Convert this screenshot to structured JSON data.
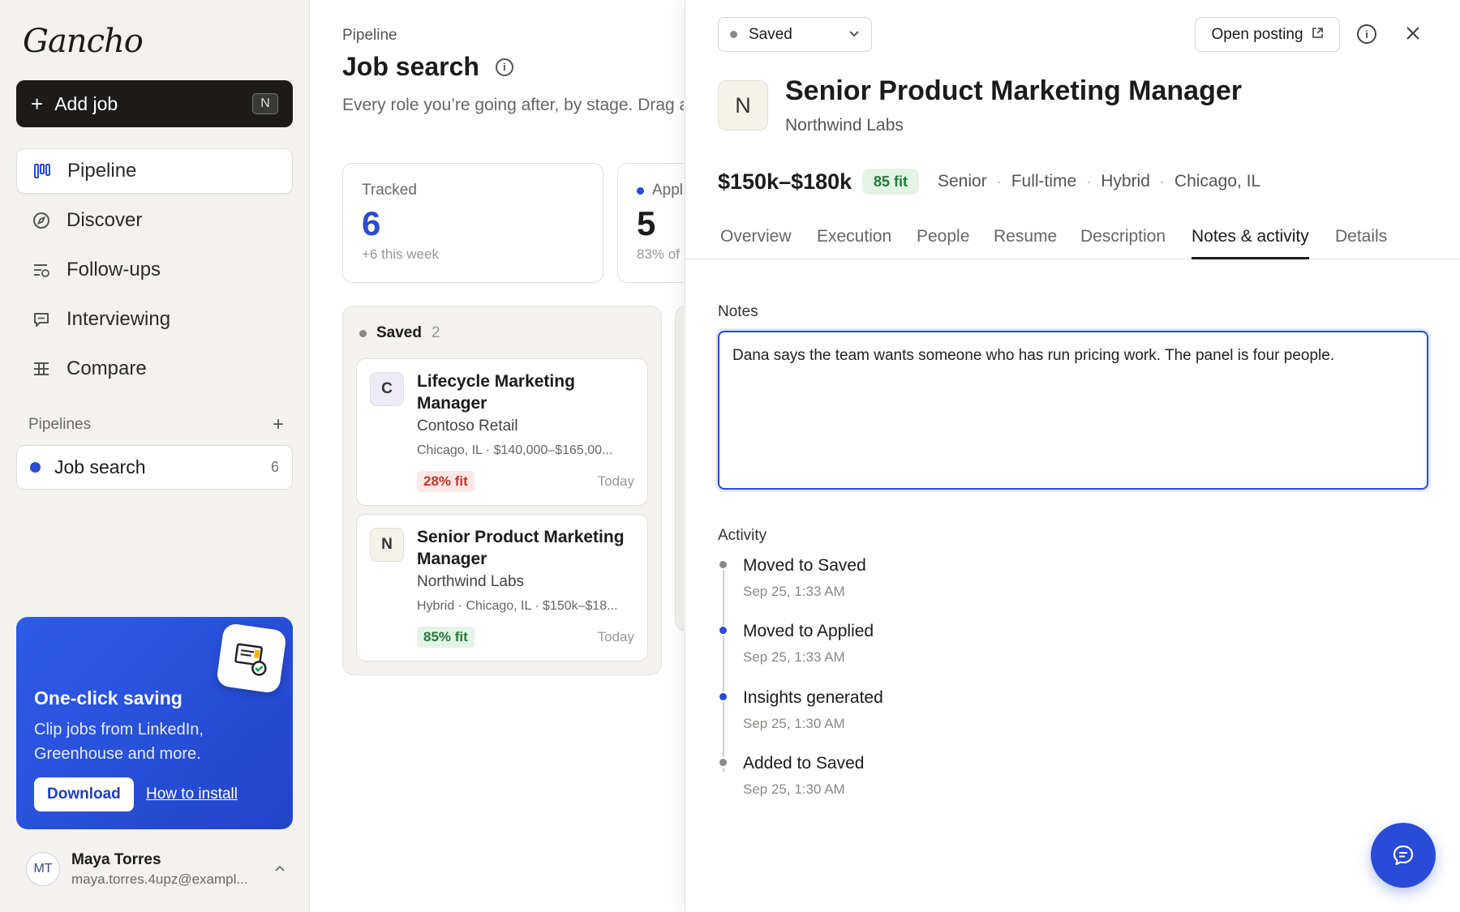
{
  "app": {
    "logo": "Gancho"
  },
  "sidebar": {
    "add_job": {
      "label": "Add job",
      "shortcut": "N"
    },
    "nav": [
      {
        "label": "Pipeline",
        "icon": "kanban-icon",
        "active": true
      },
      {
        "label": "Discover",
        "icon": "compass-icon"
      },
      {
        "label": "Follow-ups",
        "icon": "list-clock-icon"
      },
      {
        "label": "Interviewing",
        "icon": "chat-icon"
      },
      {
        "label": "Compare",
        "icon": "compare-icon"
      }
    ],
    "pipelines_heading": "Pipelines",
    "pipeline": {
      "label": "Job search",
      "count": "6",
      "color": "#2a4bd7"
    },
    "promo": {
      "title": "One-click saving",
      "text": "Clip jobs from LinkedIn, Greenhouse and more.",
      "download": "Download",
      "install": "How to install"
    },
    "user": {
      "initials": "MT",
      "name": "Maya Torres",
      "email": "maya.torres.4upz@exampl..."
    }
  },
  "main": {
    "breadcrumb": "Pipeline",
    "title": "Job search",
    "subtitle": "Every role you’re going after, by stage. Drag a",
    "stats": [
      {
        "label": "Tracked",
        "value": "6",
        "note": "+6 this week",
        "value_color": "#2a4bd7"
      },
      {
        "label": "Appl",
        "value": "5",
        "note": "83% of"
      }
    ],
    "column": {
      "name": "Saved",
      "count": "2",
      "cards": [
        {
          "logo": "C",
          "title": "Lifecycle Marketing Manager",
          "company": "Contoso Retail",
          "meta": "Chicago, IL · $140,000–$165,00...",
          "fit": "28% fit",
          "fit_level": "low",
          "date": "Today"
        },
        {
          "logo": "N",
          "title": "Senior Product Marketing Manager",
          "company": "Northwind Labs",
          "meta": "Hybrid · Chicago, IL · $150k–$18...",
          "fit": "85% fit",
          "fit_level": "high",
          "date": "Today"
        }
      ]
    }
  },
  "drawer": {
    "status": "Saved",
    "open_posting": "Open posting",
    "logo": "N",
    "title": "Senior Product Marketing Manager",
    "company": "Northwind Labs",
    "salary": "$150k–$180k",
    "fit": "85 fit",
    "attributes": [
      "Senior",
      "Full-time",
      "Hybrid",
      "Chicago, IL"
    ],
    "tabs": [
      "Overview",
      "Execution",
      "People",
      "Resume",
      "Description",
      "Notes & activity",
      "Details"
    ],
    "active_tab": "Notes & activity",
    "notes_label": "Notes",
    "notes": "Dana says the team wants someone who has run pricing work. The panel is four people.",
    "activity_label": "Activity",
    "activity": [
      {
        "title": "Moved to Saved",
        "time": "Sep 25, 1:33 AM",
        "color": "gray"
      },
      {
        "title": "Moved to Applied",
        "time": "Sep 25, 1:33 AM",
        "color": "blue"
      },
      {
        "title": "Insights generated",
        "time": "Sep 25, 1:30 AM",
        "color": "blue"
      },
      {
        "title": "Added to Saved",
        "time": "Sep 25, 1:30 AM",
        "color": "gray"
      }
    ]
  }
}
